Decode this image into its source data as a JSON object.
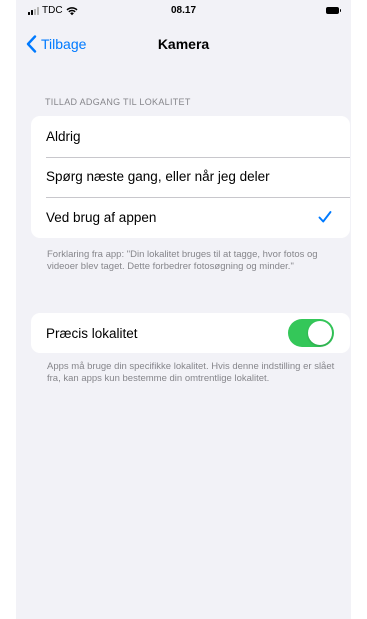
{
  "status_bar": {
    "carrier": "TDC",
    "time": "08.17"
  },
  "nav": {
    "back_label": "Tilbage",
    "title": "Kamera"
  },
  "location_section": {
    "header": "TILLAD ADGANG TIL LOKALITET",
    "options": [
      {
        "label": "Aldrig",
        "selected": false
      },
      {
        "label": "Spørg næste gang, eller når jeg deler",
        "selected": false
      },
      {
        "label": "Ved brug af appen",
        "selected": true
      }
    ],
    "footer": "Forklaring fra app: \"Din lokalitet bruges til at tagge, hvor fotos og videoer blev taget. Dette forbedrer fotosøgning og minder.\""
  },
  "precise_section": {
    "label": "Præcis lokalitet",
    "enabled": true,
    "footer": "Apps må bruge din specifikke lokalitet. Hvis denne indstilling er slået fra, kan apps kun bestemme din omtrentlige lokalitet."
  },
  "colors": {
    "accent": "#007aff",
    "toggle_on": "#34c759",
    "background": "#f2f2f7",
    "secondary_text": "#86868b"
  },
  "icons": {
    "back": "chevron-left-icon",
    "check": "checkmark-icon",
    "wifi": "wifi-icon",
    "battery": "battery-icon",
    "signal": "signal-icon"
  }
}
